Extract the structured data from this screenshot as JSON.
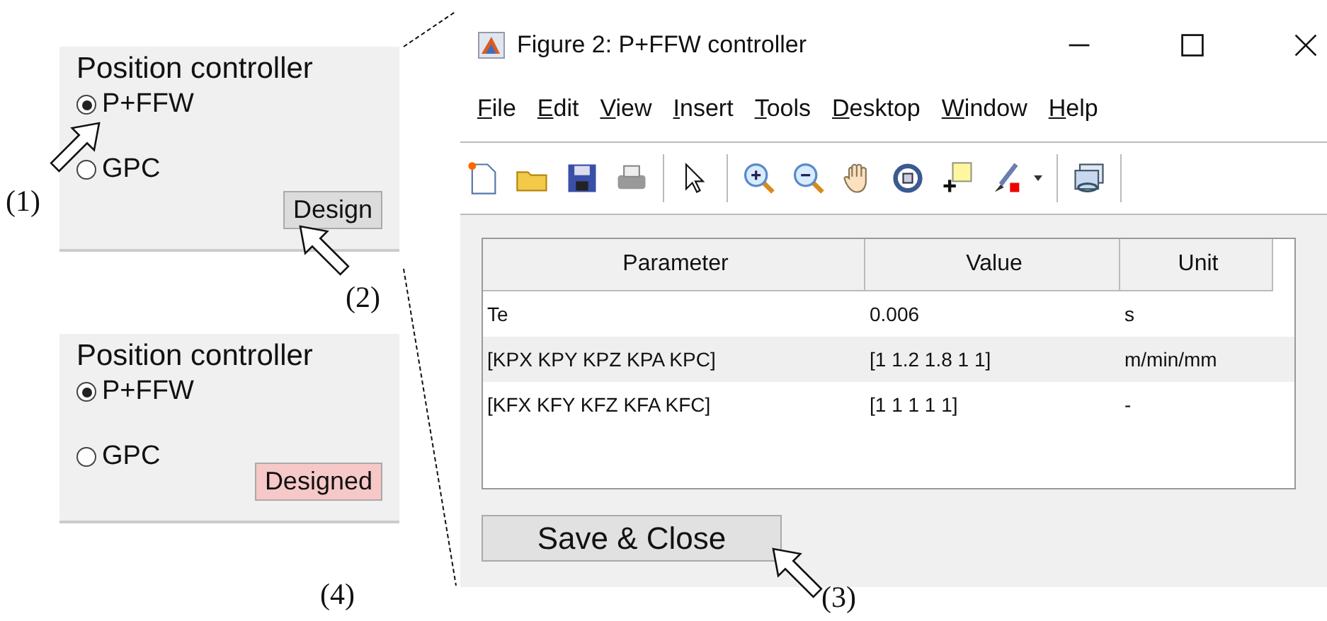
{
  "panels": [
    {
      "title": "Position controller",
      "options": [
        {
          "label": "P+FFW",
          "selected": true
        },
        {
          "label": "GPC",
          "selected": false
        }
      ],
      "button": {
        "label": "Design",
        "kind": "normal"
      }
    },
    {
      "title": "Position controller",
      "options": [
        {
          "label": "P+FFW",
          "selected": true
        },
        {
          "label": "GPC",
          "selected": false
        }
      ],
      "button": {
        "label": "Designed",
        "kind": "done"
      }
    }
  ],
  "window": {
    "title": "Figure 2: P+FFW controller",
    "menu": [
      "File",
      "Edit",
      "View",
      "Insert",
      "Tools",
      "Desktop",
      "Window",
      "Help"
    ],
    "table": {
      "columns": [
        "Parameter",
        "Value",
        "Unit"
      ],
      "rows": [
        [
          "Te",
          "0.006",
          "s"
        ],
        [
          "[KPX KPY KPZ KPA KPC]",
          "[1 1.2 1.8 1 1]",
          "m/min/mm"
        ],
        [
          "[KFX KFY KFZ KFA KFC]",
          "[1 1 1 1 1]",
          "-"
        ]
      ]
    },
    "button": "Save & Close"
  },
  "annotations": [
    "(1)",
    "(2)",
    "(3)",
    "(4)"
  ]
}
